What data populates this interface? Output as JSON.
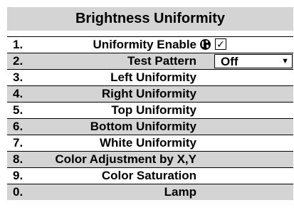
{
  "menu": {
    "title": "Brightness Uniformity",
    "items": [
      {
        "num": "1.",
        "label": "Uniformity Enable"
      },
      {
        "num": "2.",
        "label": "Test Pattern"
      },
      {
        "num": "3.",
        "label": "Left Uniformity"
      },
      {
        "num": "4.",
        "label": "Right Uniformity"
      },
      {
        "num": "5.",
        "label": "Top Uniformity"
      },
      {
        "num": "6.",
        "label": "Bottom Uniformity"
      },
      {
        "num": "7.",
        "label": "White Uniformity"
      },
      {
        "num": "8.",
        "label": "Color Adjustment by X,Y"
      },
      {
        "num": "9.",
        "label": "Color Saturation"
      },
      {
        "num": "0.",
        "label": "Lamp"
      }
    ],
    "uniformity_enable": {
      "checked": true,
      "check_glyph": "✓",
      "icon": "globe-icon"
    },
    "test_pattern": {
      "value": "Off",
      "arrow": "▼"
    }
  },
  "colors": {
    "title_bg": "#d4d4d4",
    "even_row_bg": "#d4d4d4",
    "odd_row_bg": "#ffffff",
    "text": "#000000"
  }
}
